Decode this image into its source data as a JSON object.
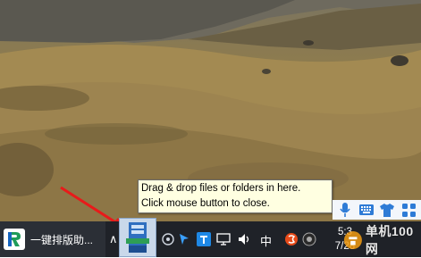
{
  "tooltip": {
    "line1": "Drag & drop files or folders in here.",
    "line2": "Click mouse button to close."
  },
  "taskbar": {
    "app_label": "一键排版助...",
    "ime_mode": "中",
    "clock_time": "5:3",
    "clock_date": "7/28",
    "colors": {
      "background": "#1f2228",
      "accent": "#2e7bd6"
    }
  },
  "watermark": {
    "text": "单机100网"
  },
  "icons": {
    "app_logo": "app-logo-icon",
    "tray_chevron": "chevron-up-icon",
    "drag_drop": "drag-drop-app-icon",
    "microphone": "microphone-icon",
    "keyboard": "keyboard-icon",
    "shirt": "skin-shirt-icon",
    "apps_grid": "apps-grid-icon"
  }
}
